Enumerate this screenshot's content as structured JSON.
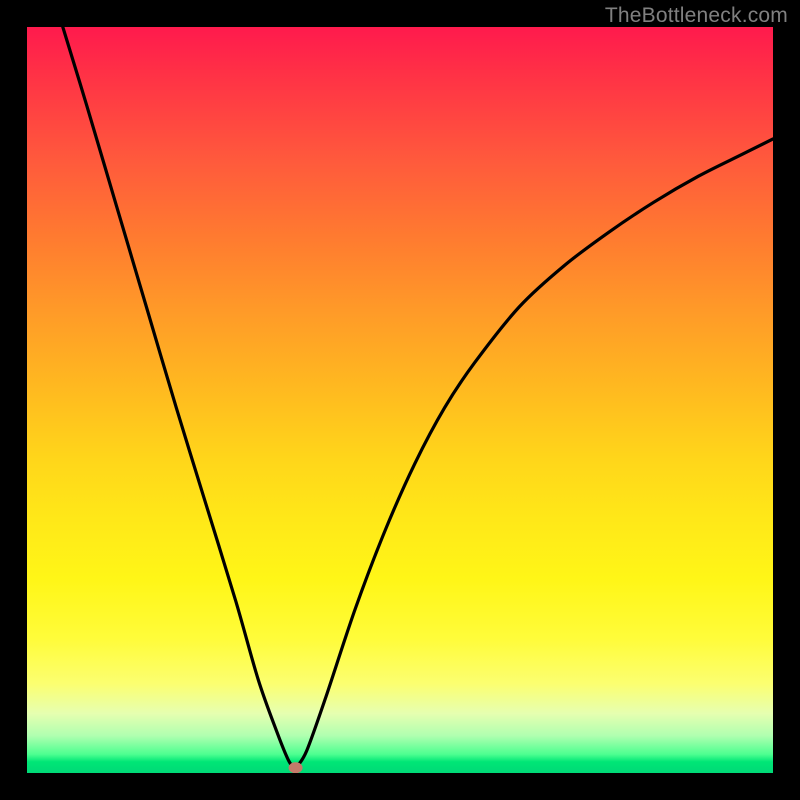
{
  "watermark": "TheBottleneck.com",
  "chart_data": {
    "type": "line",
    "title": "",
    "xlabel": "",
    "ylabel": "",
    "xlim": [
      0,
      100
    ],
    "ylim": [
      0,
      100
    ],
    "grid": false,
    "legend": false,
    "series": [
      {
        "name": "curve",
        "x": [
          4.8,
          8,
          12,
          16,
          20,
          24,
          28,
          31,
          33.5,
          35.0,
          35.8,
          36.2,
          37.5,
          40,
          44,
          48,
          52,
          56,
          60,
          66,
          72,
          78,
          84,
          90,
          96,
          100
        ],
        "values": [
          100,
          89.5,
          76,
          62.5,
          49,
          36,
          23,
          12.5,
          5.5,
          1.8,
          0.7,
          0.9,
          3.0,
          10,
          22,
          32.5,
          41.5,
          49,
          55,
          62.5,
          68,
          72.5,
          76.5,
          80,
          83,
          85
        ]
      }
    ],
    "marker": {
      "x": 36.0,
      "y": 0.7
    },
    "background_gradient": {
      "top": "#ff1a4d",
      "mid1": "#ff9a28",
      "mid2": "#fff617",
      "bottom": "#00d977"
    }
  }
}
